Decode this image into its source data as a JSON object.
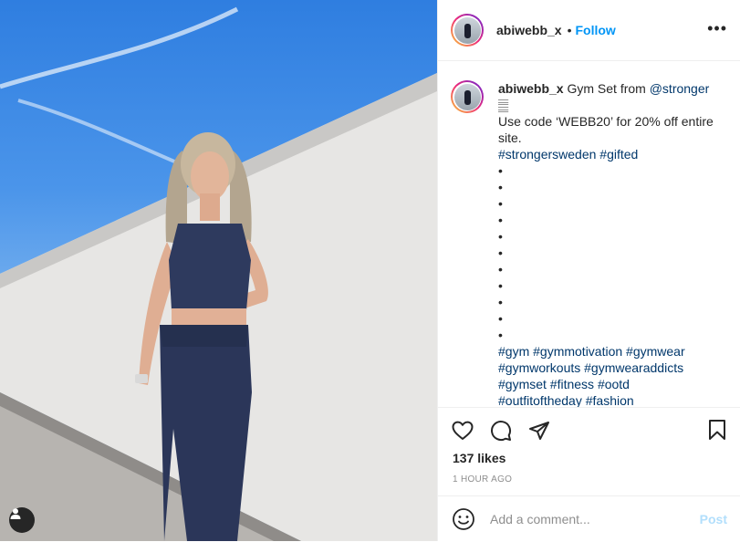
{
  "post": {
    "username": "abiwebb_x",
    "separator": "•",
    "follow_label": "Follow",
    "more_label": "•••"
  },
  "caption": {
    "username": "abiwebb_x",
    "text_1": "Gym Set from ",
    "mention": "@stronger",
    "emoji": "𝄛",
    "text_2": "Use code ‘WEBB20’ for 20% off entire site.",
    "hashtags_1": "#strongersweden #gifted",
    "bullets": [
      "•",
      "•",
      "•",
      "•",
      "•",
      "•",
      "•",
      "•",
      "•",
      "•",
      "•"
    ],
    "hashtags_2": "#gym #gymmotivation #gymwear",
    "hashtags_3": "#gymworkouts #gymwearaddicts",
    "hashtags_4": "#gymset #fitness #ootd",
    "hashtags_5": "#outfitoftheday #fashion"
  },
  "engagement": {
    "likes": "137 likes",
    "timestamp": "1 HOUR AGO"
  },
  "comment": {
    "placeholder": "Add a comment...",
    "post_label": "Post"
  },
  "icons": {
    "like": "heart-icon",
    "comment": "comment-icon",
    "share": "share-icon",
    "save": "bookmark-icon",
    "emoji": "smile-icon",
    "tag": "user-tag-icon"
  },
  "colors": {
    "link": "#00376b",
    "follow": "#0095f6",
    "post_disabled": "#b2dffc",
    "muted": "#8e8e8e"
  }
}
